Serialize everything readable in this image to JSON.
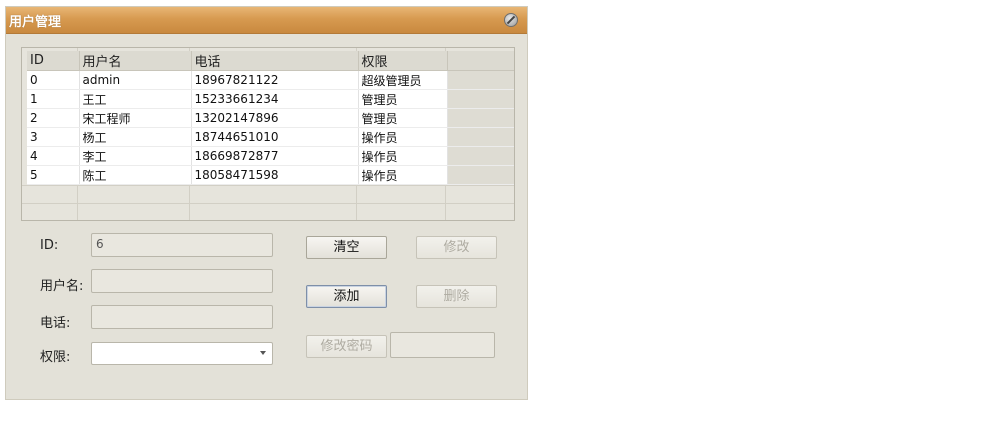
{
  "window": {
    "title": "用户管理",
    "close_icon": "close-icon"
  },
  "table": {
    "headers": [
      "ID",
      "用户名",
      "电话",
      "权限"
    ],
    "rows": [
      [
        "0",
        "admin",
        "18967821122",
        "超级管理员"
      ],
      [
        "1",
        "王工",
        "15233661234",
        "管理员"
      ],
      [
        "2",
        "宋工程师",
        "13202147896",
        "管理员"
      ],
      [
        "3",
        "杨工",
        "18744651010",
        "操作员"
      ],
      [
        "4",
        "李工",
        "18669872877",
        "操作员"
      ],
      [
        "5",
        "陈工",
        "18058471598",
        "操作员"
      ]
    ]
  },
  "form": {
    "id_label": "ID:",
    "id_value": "6",
    "username_label": "用户名:",
    "username_value": "",
    "phone_label": "电话:",
    "phone_value": "",
    "role_label": "权限:",
    "role_value": "",
    "password_value": ""
  },
  "buttons": {
    "clear": "清空",
    "modify": "修改",
    "add": "添加",
    "delete": "删除",
    "change_password": "修改密码"
  }
}
